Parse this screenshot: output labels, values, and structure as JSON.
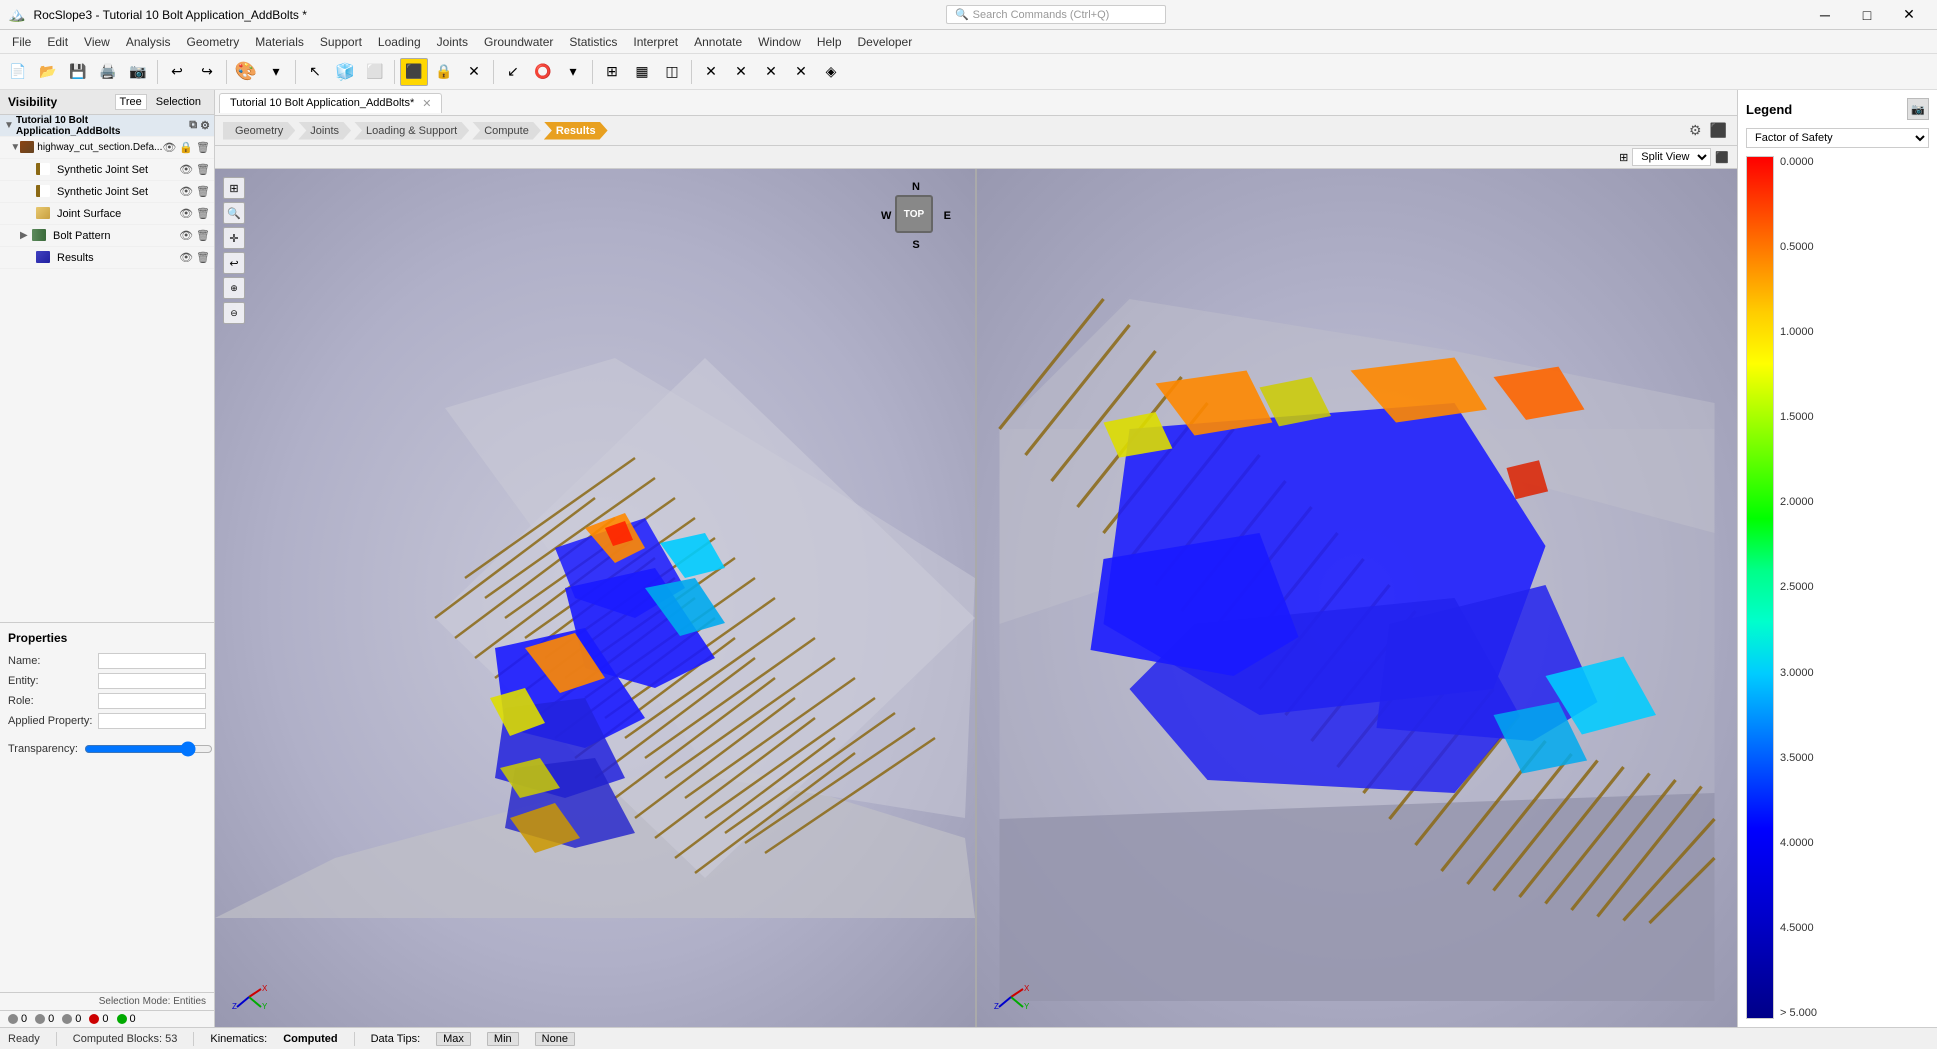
{
  "titlebar": {
    "title": "RocSlope3 - Tutorial 10 Bolt Application_AddBolts *",
    "search_placeholder": "Search Commands (Ctrl+Q)"
  },
  "menubar": {
    "items": [
      "File",
      "Edit",
      "View",
      "Analysis",
      "Geometry",
      "Materials",
      "Support",
      "Loading",
      "Joints",
      "Groundwater",
      "Statistics",
      "Interpret",
      "Annotate",
      "Window",
      "Help",
      "Developer"
    ]
  },
  "tab": {
    "label": "Tutorial 10 Bolt Application_AddBolts*"
  },
  "workflow": {
    "steps": [
      "Geometry",
      "Joints",
      "Loading & Support",
      "Compute",
      "Results"
    ],
    "active": "Results"
  },
  "split_view": {
    "label": "Split View",
    "option": "Split View"
  },
  "visibility": {
    "title": "Visibility",
    "tab_tree": "Tree",
    "tab_selection": "Selection"
  },
  "tree": {
    "root_label": "Tutorial 10 Bolt Application_AddBolts",
    "items": [
      {
        "id": "terrain",
        "indent": 1,
        "label": "highway_cut_section.Defa...",
        "icon": "terrain",
        "expanded": true
      },
      {
        "id": "synth-joint1",
        "indent": 2,
        "label": "Synthetic Joint Set",
        "icon": "joint-set"
      },
      {
        "id": "synth-joint2",
        "indent": 2,
        "label": "Synthetic Joint Set",
        "icon": "joint-set"
      },
      {
        "id": "joint-surface",
        "indent": 2,
        "label": "Joint Surface",
        "icon": "surface"
      },
      {
        "id": "bolt-pattern",
        "indent": 2,
        "label": "Bolt Pattern",
        "icon": "bolt"
      },
      {
        "id": "results",
        "indent": 2,
        "label": "Results",
        "icon": "results"
      }
    ]
  },
  "properties": {
    "title": "Properties",
    "fields": [
      {
        "label": "Name:",
        "value": ""
      },
      {
        "label": "Entity:",
        "value": ""
      },
      {
        "label": "Role:",
        "value": ""
      },
      {
        "label": "Applied Property:",
        "value": ""
      }
    ],
    "transparency": {
      "label": "Transparency:",
      "value": "85 %"
    }
  },
  "selection_mode": "Selection Mode: Entities",
  "status_dots": [
    {
      "color": "#888888",
      "count": "0"
    },
    {
      "color": "#888888",
      "count": "0"
    },
    {
      "color": "#888888",
      "count": "0"
    },
    {
      "color": "#cc0000",
      "count": "0"
    },
    {
      "color": "#00aa00",
      "count": "0"
    }
  ],
  "legend": {
    "title": "Legend",
    "dropdown_label": "Factor of Safety",
    "ramp_labels": [
      "0.0000",
      "0.5000",
      "1.0000",
      "1.5000",
      "2.0000",
      "2.5000",
      "3.0000",
      "3.5000",
      "4.0000",
      "4.5000",
      "> 5.000"
    ]
  },
  "statusbar": {
    "ready": "Ready",
    "computed_blocks": "Computed Blocks: 53",
    "kinematics_label": "Kinematics:",
    "kinematics_value": "Computed",
    "data_tips_label": "Data Tips:",
    "btn_max": "Max",
    "btn_min": "Min",
    "btn_none": "None"
  },
  "compass": {
    "n": "N",
    "s": "S",
    "e": "E",
    "w": "W",
    "top": "TOP"
  }
}
